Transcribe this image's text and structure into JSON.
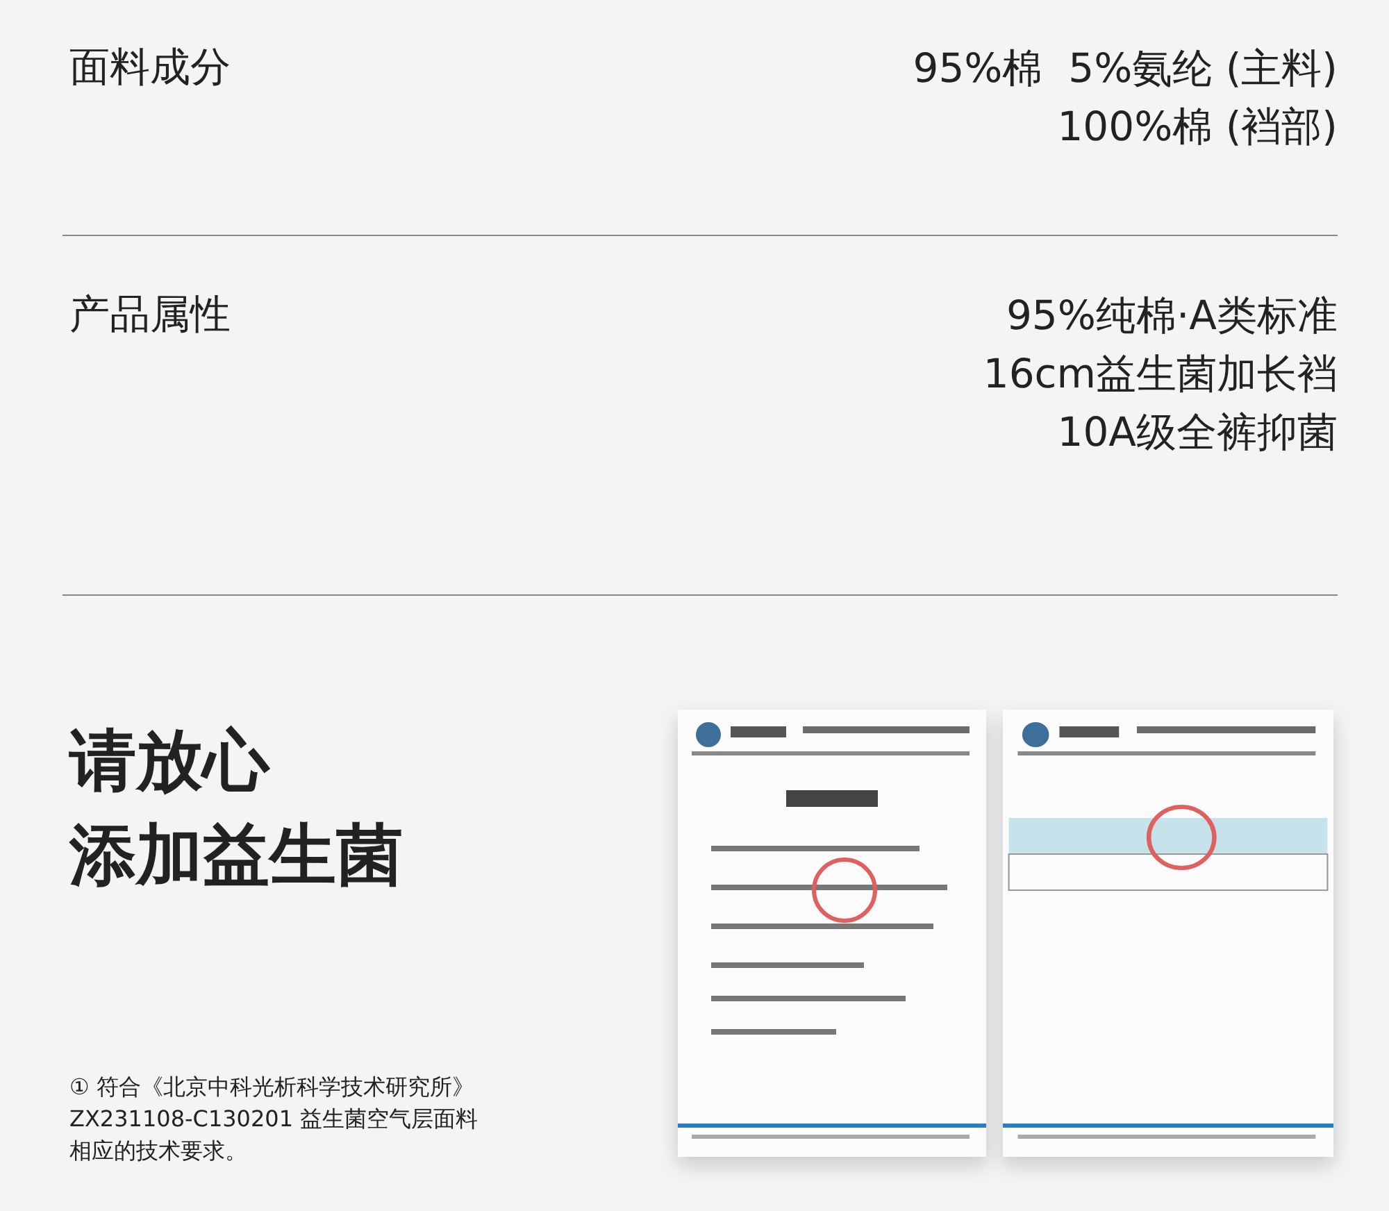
{
  "specs": [
    {
      "label": "面料成分",
      "values": [
        "95%棉  5%氨纶 (主料)",
        "100%棉 (裆部)"
      ]
    },
    {
      "label": "产品属性",
      "values": [
        "95%纯棉·A类标准",
        "16cm益生菌加长裆",
        "10A级全裤抑菌"
      ]
    }
  ],
  "promo": {
    "headline": [
      "请放心",
      "添加益生菌"
    ],
    "footnote": [
      "① 符合《北京中科光析科学技术研究所》",
      "ZX231108-C130201 益生菌空气层面料",
      "相应的技术要求。"
    ],
    "documents": [
      {
        "kind": "picture"
      },
      {
        "kind": "picture"
      }
    ]
  }
}
